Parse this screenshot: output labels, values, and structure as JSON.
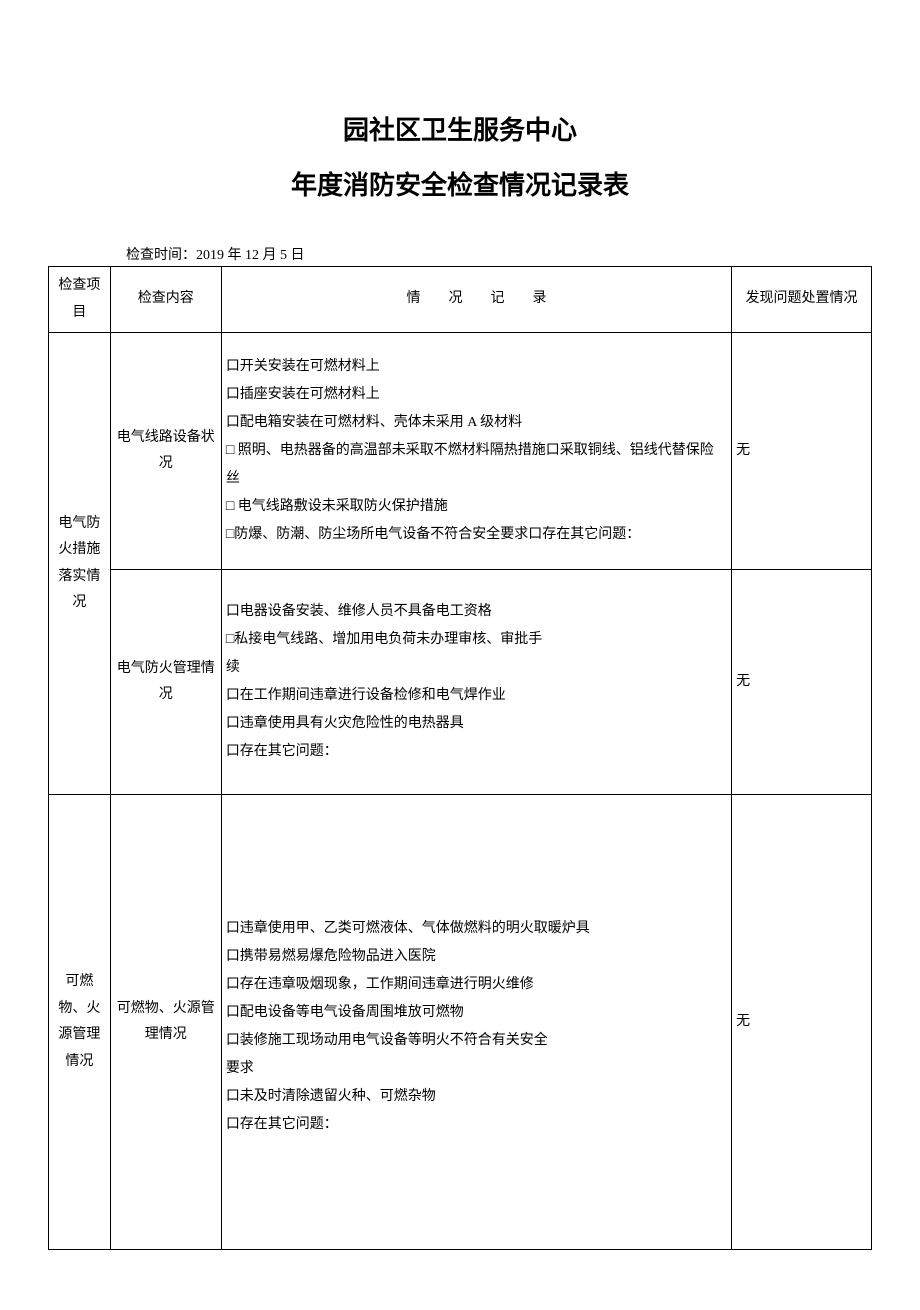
{
  "title1": "园社区卫生服务中心",
  "title2": "年度消防安全检查情况记录表",
  "meta_label": "检查时间：",
  "meta_value": "2019 年 12 月 5 日",
  "headers": {
    "category": "检查项目",
    "content": "检查内容",
    "record_c1": "情",
    "record_c2": "况",
    "record_c3": "记",
    "record_c4": "录",
    "action": "发现问题处置情况"
  },
  "cat1": "电气防火措施落实情况",
  "row1": {
    "content": "电气线路设备状况",
    "line1": "口开关安装在可燃材料上",
    "line2": "口插座安装在可燃材料上",
    "line3": "口配电箱安装在可燃材料、壳体未采用 A 级材料",
    "line4": "□ 照明、电热器备的高温部未采取不燃材料隔热措施口采取铜线、铝线代替保险丝",
    "line5": "□ 电气线路敷设未采取防火保护措施",
    "line6": "□防爆、防潮、防尘场所电气设备不符合安全要求口存在其它问题：",
    "action": "无"
  },
  "row2": {
    "content": "电气防火管理情况",
    "line1": "口电器设备安装、维修人员不具备电工资格",
    "line2": "□私接电气线路、增加用电负荷未办理审核、审批手",
    "line3": "续",
    "line4": "口在工作期间违章进行设备检修和电气焊作业",
    "line5": "口违章使用具有火灾危险性的电热器具",
    "line6": "口存在其它问题：",
    "action": "无"
  },
  "cat2": "可燃物、火源管理情况",
  "row3": {
    "content": "可燃物、火源管理情况",
    "line1": "口违章使用甲、乙类可燃液体、气体做燃料的明火取暖炉具",
    "line2": "口携带易燃易爆危险物品进入医院",
    "line3": "口存在违章吸烟现象，工作期间违章进行明火维修",
    "line4": "口配电设备等电气设备周围堆放可燃物",
    "line5": "口装修施工现场动用电气设备等明火不符合有关安全",
    "line6": "要求",
    "line7": "口未及时清除遗留火种、可燃杂物",
    "line8": "口存在其它问题：",
    "action": "无"
  }
}
